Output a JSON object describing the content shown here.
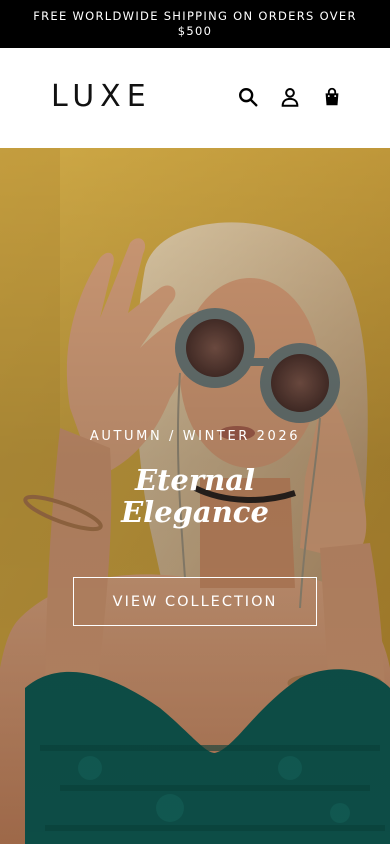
{
  "announcement": {
    "text": "FREE WORLDWIDE SHIPPING ON ORDERS OVER $500"
  },
  "header": {
    "logo": "LUXE",
    "icons": [
      "search-icon",
      "user-icon",
      "shopping-bag-icon"
    ]
  },
  "hero": {
    "eyebrow": "AUTUMN / WINTER 2026",
    "title_line1": "Eternal",
    "title_line2": "Elegance",
    "cta_label": "VIEW COLLECTION"
  },
  "colors": {
    "announcement_bg": "#000000",
    "hero_background": "#c9a440",
    "top_color": "#0f5a52",
    "text_light": "#ffffff"
  }
}
